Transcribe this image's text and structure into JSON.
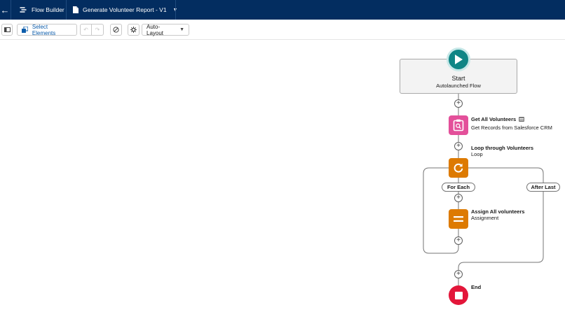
{
  "header": {
    "app_title": "Flow Builder",
    "flow_title": "Generate Volunteer Report - V1",
    "icons": [
      "back-arrow-icon",
      "flow-icon",
      "document-icon",
      "chevron-down-icon"
    ]
  },
  "toolbar": {
    "select_elements_label": "Select Elements",
    "layout_select_value": "Auto-Layout",
    "icons": [
      "toggle-panel-icon",
      "select-elements-icon",
      "undo-icon",
      "redo-icon",
      "debug-icon",
      "settings-icon"
    ]
  },
  "flow": {
    "start": {
      "title": "Start",
      "subtitle": "Autolaunched Flow"
    },
    "get_records": {
      "label": "Get All Volunteers",
      "subtitle": "Get Records from Salesforce CRM",
      "color": "#e3509a"
    },
    "loop": {
      "label": "Loop through Volunteers",
      "subtitle": "Loop",
      "color": "#dd7a01"
    },
    "for_each_label": "For Each",
    "after_last_label": "After Last",
    "assignment": {
      "label": "Assign All volunteers",
      "subtitle": "Assignment",
      "color": "#dd7a01"
    },
    "end": {
      "label": "End",
      "color": "#e3163a"
    }
  },
  "colors": {
    "header_bg": "#032d60",
    "start_circle": "#0f8585",
    "brand_blue": "#0b5cab"
  }
}
